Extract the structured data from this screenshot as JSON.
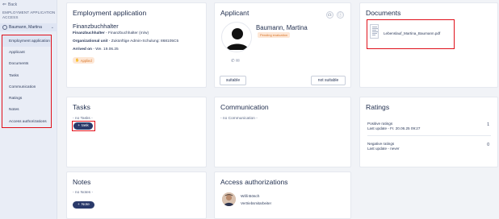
{
  "sidebar": {
    "back_label": "Back",
    "section_title": "EMPLOYMENT APPLICATION ACCESS",
    "person_name": "Baumann, Martina",
    "items": [
      {
        "label": "Employment application"
      },
      {
        "label": "Applicant"
      },
      {
        "label": "Documents"
      },
      {
        "label": "Tasks"
      },
      {
        "label": "Communication"
      },
      {
        "label": "Ratings"
      },
      {
        "label": "Notes"
      },
      {
        "label": "Access authorizations"
      }
    ]
  },
  "employment": {
    "title": "Employment application",
    "position": "Finanzbuchhalter",
    "position_label": "Finanzbuchhalter",
    "position_value": "Finanzbuchhalter (m/w)",
    "org_label": "Organizational unit",
    "org_value": "Zukünftige Admin-Schulung: 868105C5",
    "arrived_label": "Arrived on",
    "arrived_value": "We. 19.06.25",
    "status_badge": "Applied"
  },
  "applicant": {
    "title": "Applicant",
    "name": "Baumann, Martina",
    "status": "Pending evaluation",
    "suitable_label": "suitable",
    "not_suitable_label": "not suitable"
  },
  "documents": {
    "title": "Documents",
    "file_name": "Lebenslauf_Martina_Baumann.pdf"
  },
  "tasks": {
    "title": "Tasks",
    "empty": "- no Tasks -",
    "add_label": "task"
  },
  "communication": {
    "title": "Communication",
    "empty": "- no Communication -"
  },
  "ratings": {
    "title": "Ratings",
    "positive_label": "Positive ratings",
    "positive_update": "Last update - Fr. 20.06.25 09:27",
    "positive_count": "1",
    "negative_label": "Negative ratings",
    "negative_update": "Last update - never",
    "negative_count": "0"
  },
  "notes": {
    "title": "Notes",
    "empty": "- no Notes -",
    "add_label": "Note"
  },
  "access": {
    "title": "Access authorizations",
    "person_name": "Willi Bösch",
    "person_role": "Vertriebsmitarbeiter"
  }
}
